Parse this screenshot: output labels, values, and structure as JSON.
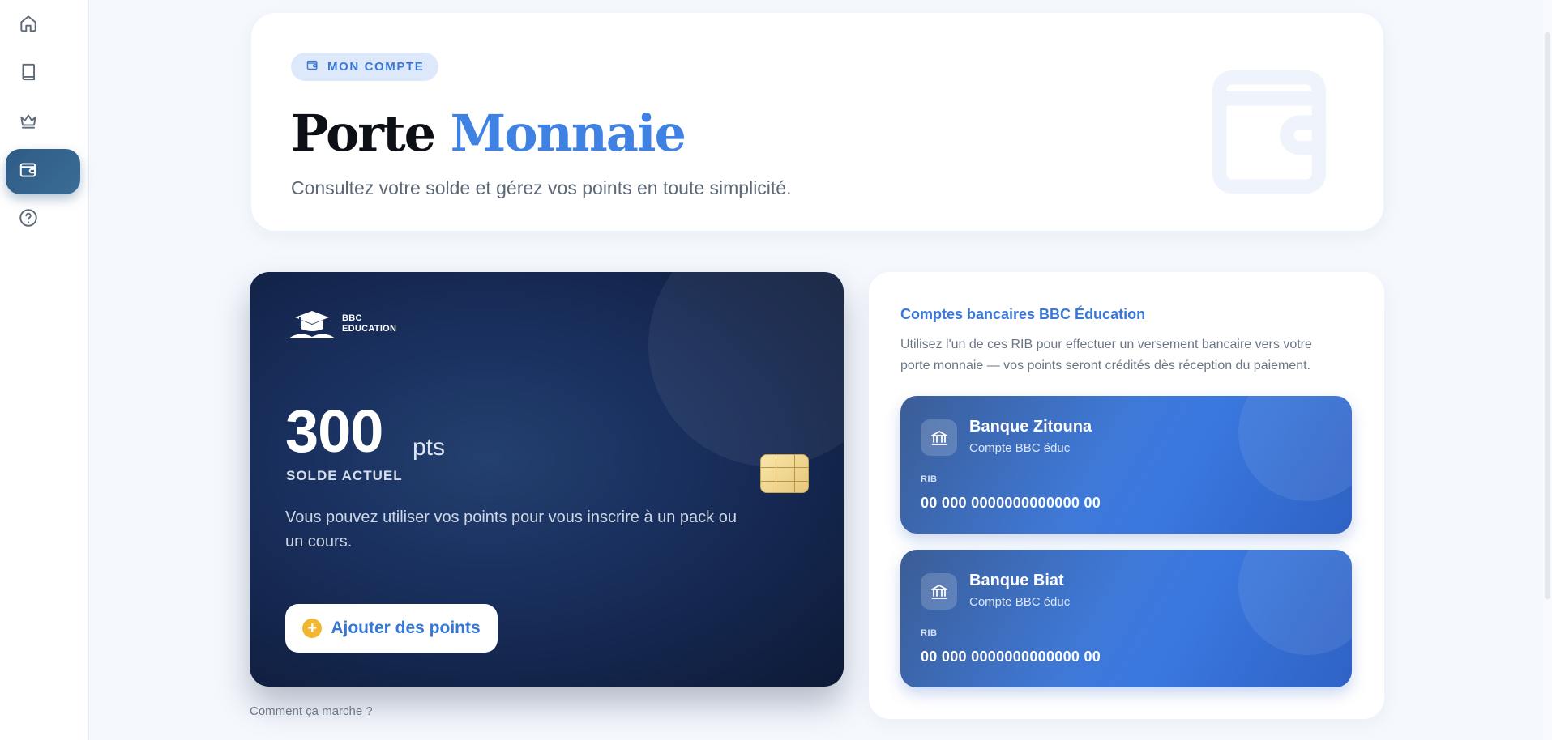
{
  "sidebar": {
    "items": [
      {
        "name": "home",
        "icon": "home-icon"
      },
      {
        "name": "courses",
        "icon": "book-icon"
      },
      {
        "name": "premium",
        "icon": "crown-icon"
      },
      {
        "name": "wallet",
        "icon": "wallet-icon",
        "active": true
      },
      {
        "name": "help",
        "icon": "help-circle-icon"
      }
    ]
  },
  "hero": {
    "badge": "MON COMPTE",
    "title_part1": "Porte",
    "title_part2": "Monnaie",
    "subtitle": "Consultez votre solde et gérez vos points en toute simplicité.",
    "watermark_icon": "wallet-icon"
  },
  "balance_card": {
    "brand_line1": "BBC",
    "brand_line2": "EDUCATION",
    "points": "300",
    "unit": "pts",
    "caption": "SOLDE ACTUEL",
    "description": "Vous pouvez utiliser vos points pour vous inscrire à un pack ou un cours.",
    "add_button": "Ajouter des points"
  },
  "how_link": "Comment ça marche ?",
  "bank_panel": {
    "title": "Comptes bancaires BBC Éducation",
    "description": "Utilisez l'un de ces RIB pour effectuer un versement bancaire vers votre porte monnaie — vos points seront crédités dès réception du paiement.",
    "banks": [
      {
        "name": "Banque Zitouna",
        "subtitle": "Compte BBC éduc",
        "rib_label": "RIB",
        "rib": "00 000 0000000000000 00"
      },
      {
        "name": "Banque Biat",
        "subtitle": "Compte BBC éduc",
        "rib_label": "RIB",
        "rib": "00 000 0000000000000 00"
      }
    ]
  },
  "colors": {
    "accent": "#3f82e4",
    "sidebar_active": "#2e5b85",
    "card_dark": "#13244a",
    "button_plus": "#f2b731"
  }
}
